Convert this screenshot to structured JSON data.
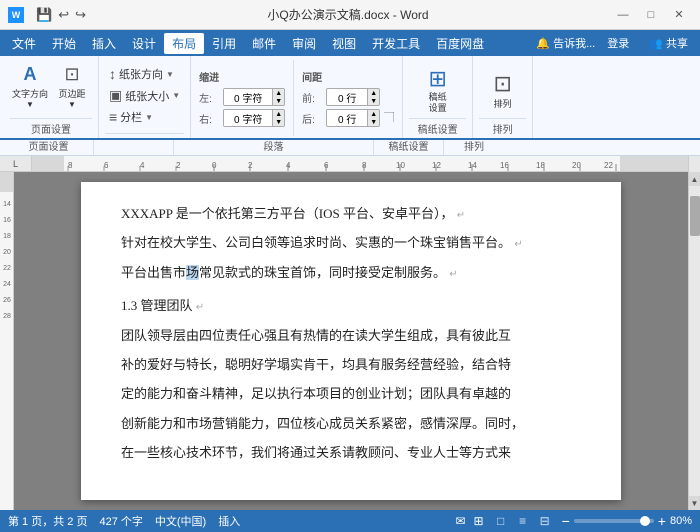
{
  "titleBar": {
    "appIcon": "W",
    "quickAccess": [
      "💾",
      "↩",
      "↪"
    ],
    "title": "小Q办公演示文稿.docx - Word",
    "windowButtons": [
      "—",
      "□",
      "✕"
    ]
  },
  "menuBar": {
    "items": [
      "文件",
      "开始",
      "插入",
      "设计",
      "布局",
      "引用",
      "邮件",
      "审阅",
      "视图",
      "开发工具",
      "百度网盘"
    ],
    "activeItem": "布局",
    "rightItems": [
      "🔔 告诉我...",
      "登录",
      "共享"
    ]
  },
  "ribbon": {
    "groups": [
      {
        "id": "text-direction",
        "label": "页面设置",
        "buttons": [
          {
            "id": "text-dir",
            "icon": "A",
            "label": "文字方向"
          },
          {
            "id": "margins",
            "icon": "▤",
            "label": "页边距"
          }
        ]
      },
      {
        "id": "page-setup",
        "label": "",
        "rows": [
          {
            "icon": "↕",
            "label": "纸张方向",
            "dropdown": true
          },
          {
            "icon": "▣",
            "label": "纸张大小",
            "dropdown": true
          },
          {
            "icon": "≡",
            "label": "分栏",
            "dropdown": true
          }
        ]
      },
      {
        "id": "indent-spacing",
        "label": "段落",
        "indent": {
          "label": "缩进",
          "left": {
            "label": "左:",
            "value": "0 字符"
          },
          "right": {
            "label": "右:",
            "value": "0 字符"
          }
        },
        "spacing": {
          "label": "间距",
          "before": {
            "label": "前:",
            "value": "0 行"
          },
          "after": {
            "label": "后:",
            "value": "0 行"
          }
        }
      },
      {
        "id": "page-bg",
        "label": "稿纸设置",
        "bigBtn": {
          "icon": "⊞",
          "label": "稿纸\n设置"
        }
      },
      {
        "id": "arrange",
        "label": "排列",
        "bigBtn": {
          "icon": "⊡",
          "label": "排列"
        }
      }
    ]
  },
  "ruler": {
    "marks": [
      {
        "pos": 8,
        "label": "8"
      },
      {
        "pos": 18,
        "label": ""
      },
      {
        "pos": 28,
        "label": ""
      },
      {
        "pos": 38,
        "label": ""
      },
      {
        "pos": 48,
        "label": ""
      },
      {
        "pos": 58,
        "label": ""
      },
      {
        "pos": 68,
        "label": ""
      },
      {
        "pos": 78,
        "label": ""
      },
      {
        "pos": 88,
        "label": ""
      }
    ]
  },
  "document": {
    "paragraphs": [
      {
        "id": "p1",
        "text": "XXXAPP 是一个依托第三方平台（IOS 平台、安卓平台），",
        "pilcrow": true
      },
      {
        "id": "p2",
        "text": "针对在校大学生、公司白领等追求时尚、实惠的一个珠宝销售平台。",
        "pilcrow": true
      },
      {
        "id": "p3",
        "text": "平台出售市场常见款式的珠宝首饰，同时接受定制服务。",
        "hasHighlight": true,
        "highlightWord": "场",
        "pilcrow": true
      },
      {
        "id": "h1",
        "text": "1.3 管理团队",
        "isHeading": true,
        "pilcrow": true
      },
      {
        "id": "p4",
        "text": "团队领导层由四位责任心强且有热情的在读大学生组成，具有彼此互",
        "pilcrow": false
      },
      {
        "id": "p4b",
        "text": "补的爱好与特长，聪明好学塌实肯干，均具有服务经营经验，结合特",
        "pilcrow": false
      },
      {
        "id": "p4c",
        "text": "定的能力和奋斗精神，足以执行本项目的创业计划；团队具有卓越的",
        "pilcrow": false
      },
      {
        "id": "p4d",
        "text": "创新能力和市场营销能力，四位核心成员关系紧密，感情深厚。同时，",
        "pilcrow": false
      },
      {
        "id": "p5",
        "text": "在一些核心技术环节，我们将通过关系请教顾问、专业人士等方式来"
      }
    ]
  },
  "statusBar": {
    "page": "第 1 页，共 2 页",
    "wordCount": "427 个字",
    "lang": "中文(中国)",
    "mode": "插入",
    "notifications": [
      "✉",
      "⊞"
    ],
    "viewModes": [
      "□",
      "≡",
      "⊟"
    ],
    "zoom": "80%"
  }
}
